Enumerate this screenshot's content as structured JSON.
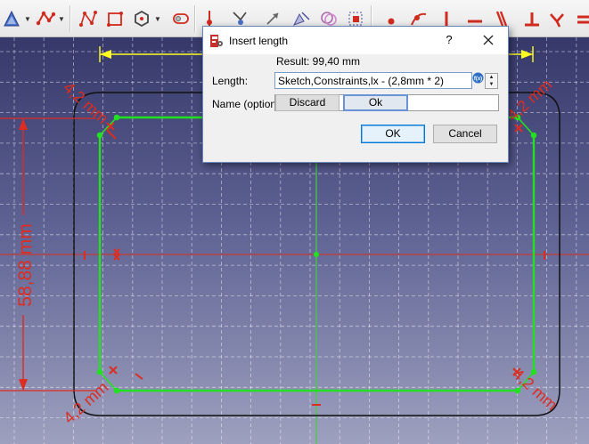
{
  "colors": {
    "constraint_red": "#dd2c20",
    "geometry_green": "#22e022",
    "axis_green": "#3fd03f",
    "outline_black": "#111111",
    "reference_yellow": "#ffff22",
    "grid_white": "#ffffff",
    "toolbar_red": "#d12a1e"
  },
  "toolbar": {
    "tools": [
      {
        "name": "sketcher-view-icon"
      },
      {
        "name": "polyline-icon"
      },
      {
        "name": "bspline-icon"
      },
      {
        "name": "rectangle-icon"
      },
      {
        "name": "polygon-icon"
      },
      {
        "name": "slot-icon"
      },
      {
        "name": "point-on-object-icon"
      },
      {
        "name": "trim-icon"
      },
      {
        "name": "extend-icon"
      },
      {
        "name": "carbon-copy-icon"
      },
      {
        "name": "clone-icon"
      },
      {
        "name": "array-icon"
      },
      {
        "name": "constrain-coincident-icon"
      },
      {
        "name": "constrain-point-on-object-icon"
      },
      {
        "name": "constrain-vertical-icon"
      },
      {
        "name": "constrain-horizontal-icon"
      },
      {
        "name": "constrain-parallel-icon"
      },
      {
        "name": "constrain-perpendicular-icon"
      },
      {
        "name": "constrain-tangent-icon"
      },
      {
        "name": "constrain-equal-icon"
      }
    ]
  },
  "sketch": {
    "dimensions": {
      "height_label": "58,88 mm",
      "radius_top_left": "4,2 mm",
      "radius_top_right": "4,2 mm",
      "radius_bottom_left": "4,2 mm",
      "radius_bottom_right": "4,2 mm"
    }
  },
  "dialog": {
    "title": "Insert length",
    "help_glyph": "?",
    "result": "Result: 99,40 mm",
    "length_label": "Length:",
    "length_value": "Sketch,Constraints,lx - (2,8mm * 2)",
    "name_label": "Name (optional)",
    "discard_label": "Discard",
    "ok_inline_label": "Ok",
    "ok_label": "OK",
    "cancel_label": "Cancel"
  }
}
